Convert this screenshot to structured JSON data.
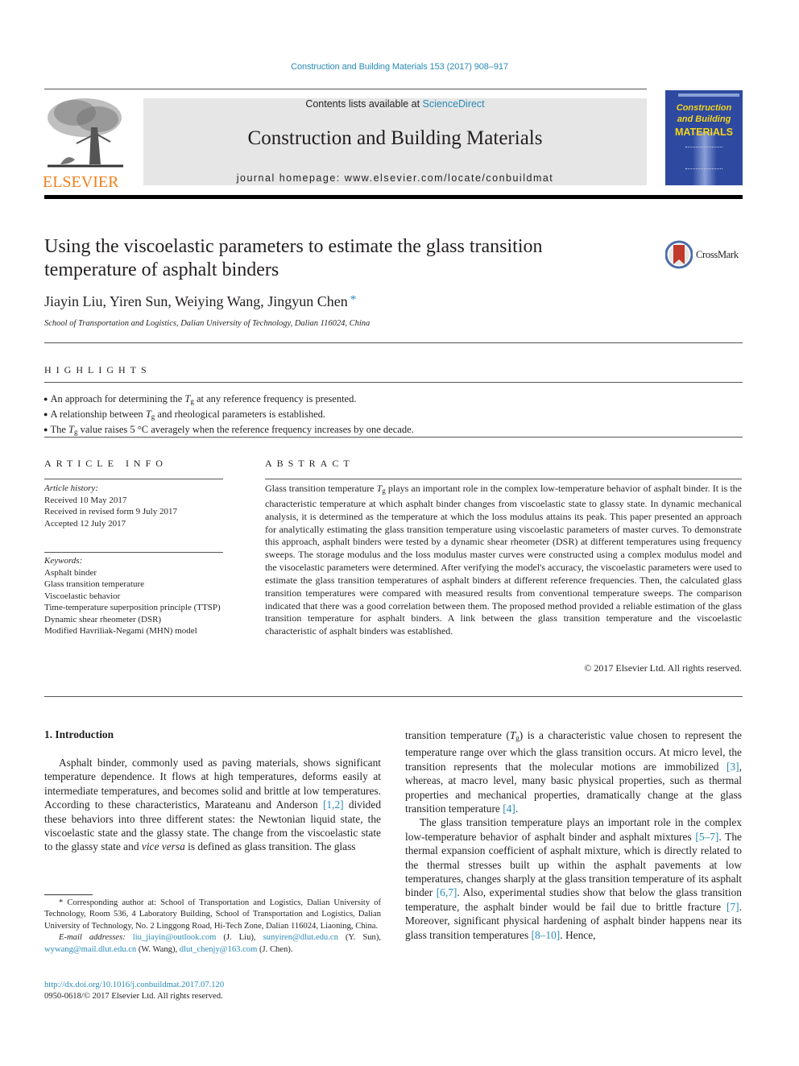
{
  "header": {
    "journal_ref": "Construction and Building Materials 153 (2017) 908–917",
    "contents_prefix": "Contents lists available at ",
    "contents_link": "ScienceDirect",
    "journal_name": "Construction and Building Materials",
    "homepage": "journal homepage: www.elsevier.com/locate/conbuildmat",
    "publisher_logo_text": "ELSEVIER",
    "cover": {
      "title_line1": "Construction",
      "title_line2": "and Building",
      "title_line3": "MATERIALS"
    },
    "colors": {
      "link": "#2a8ab5",
      "elsevier_orange": "#f07f1b",
      "cover_blue": "#2e4aa0",
      "cover_yellow": "#f5d41a",
      "masthead_gray": "#e6e6e6"
    }
  },
  "article": {
    "title": "Using the viscoelastic parameters to estimate the glass transition temperature of asphalt binders",
    "crossmark_label": "CrossMark",
    "authors": "Jiayin Liu, Yiren Sun, Weiying Wang, Jingyun Chen",
    "corresponding_mark": "*",
    "affiliation": "School of Transportation and Logistics, Dalian University of Technology, Dalian 116024, China"
  },
  "highlights": {
    "heading": "HIGHLIGHTS",
    "items": [
      {
        "pre": "An approach for determining the ",
        "sym": "T",
        "sub": "g",
        "post": " at any reference frequency is presented."
      },
      {
        "pre": "A relationship between ",
        "sym": "T",
        "sub": "g",
        "post": " and rheological parameters is established."
      },
      {
        "pre": "The ",
        "sym": "T",
        "sub": "g",
        "post": " value raises 5 °C averagely when the reference frequency increases by one decade."
      }
    ]
  },
  "article_info": {
    "heading": "ARTICLE INFO",
    "history_label": "Article history:",
    "history": [
      "Received 10 May 2017",
      "Received in revised form 9 July 2017",
      "Accepted 12 July 2017"
    ],
    "keywords_label": "Keywords:",
    "keywords": [
      "Asphalt binder",
      "Glass transition temperature",
      "Viscoelastic behavior",
      "Time-temperature superposition principle (TTSP)",
      "Dynamic shear rheometer (DSR)",
      "Modified Havriliak-Negami (MHN) model"
    ]
  },
  "abstract": {
    "heading": "ABSTRACT",
    "lead": "Glass transition temperature ",
    "sym": "T",
    "sub": "g",
    "text": " plays an important role in the complex low-temperature behavior of asphalt binder. It is the characteristic temperature at which asphalt binder changes from viscoelastic state to glassy state. In dynamic mechanical analysis, it is determined as the temperature at which the loss modulus attains its peak. This paper presented an approach for analytically estimating the glass transition temperature using viscoelastic parameters of master curves. To demonstrate this approach, asphalt binders were tested by a dynamic shear rheometer (DSR) at different temperatures using frequency sweeps. The storage modulus and the loss modulus master curves were constructed using a complex modulus model and the visocelastic parameters were determined. After verifying the model's accuracy, the viscoelastic parameters were used to estimate the glass transition temperatures of asphalt binders at different reference frequencies. Then, the calculated glass transition temperatures were compared with measured results from conventional temperature sweeps. The comparison indicated that there was a good correlation between them. The proposed method provided a reliable estimation of the glass transition temperature for asphalt binders. A link between the glass transition temperature and the viscoelastic characteristic of asphalt binders was established.",
    "copyright": "© 2017 Elsevier Ltd. All rights reserved."
  },
  "body": {
    "section_heading": "1. Introduction",
    "left_para": {
      "p1": "Asphalt binder, commonly used as paving materials, shows significant temperature dependence. It flows at high temperatures, deforms easily at intermediate temperatures, and becomes solid and brittle at low temperatures. According to these characteristics, Marateanu and Anderson ",
      "ref1": "[1,2]",
      "p2": " divided these behaviors into three different states: the Newtonian liquid state, the viscoelastic state and the glassy state. The change from the viscoelastic state to the glassy state and ",
      "italic": "vice versa",
      "p3": " is defined as glass transition. The glass"
    },
    "right_para1": {
      "p1": "transition temperature (",
      "sym": "T",
      "sub": "g",
      "p2": ") is a characteristic value chosen to represent the temperature range over which the glass transition occurs. At micro level, the transition represents that the molecular motions are immobilized ",
      "ref3": "[3]",
      "p3": ", whereas, at macro level, many basic physical properties, such as thermal properties and mechanical properties, dramatically change at the glass transition temperature ",
      "ref4": "[4]",
      "p4": "."
    },
    "right_para2": {
      "p1": "The glass transition temperature plays an important role in the complex low-temperature behavior of asphalt binder and asphalt mixtures ",
      "ref5": "[5–7]",
      "p2": ". The thermal expansion coefficient of asphalt mixture, which is directly related to the thermal stresses built up within the asphalt pavements at low temperatures, changes sharply at the glass transition temperature of its asphalt binder ",
      "ref6": "[6,7]",
      "p3": ". Also, experimental studies show that below the glass transition temperature, the asphalt binder would be fail due to brittle fracture ",
      "ref7": "[7]",
      "p4": ". Moreover, significant physical hardening of asphalt binder happens near its glass transition temperatures ",
      "ref8": "[8–10]",
      "p5": ". Hence,"
    }
  },
  "footnote": {
    "star": "*",
    "corresponding": " Corresponding author at: School of Transportation and Logistics, Dalian University of Technology, Room 536, 4 Laboratory Building, School of Transportation and Logistics, Dalian University of Technology, No. 2 Linggong Road, Hi-Tech Zone, Dalian 116024, Liaoning, China.",
    "email_label": "E-mail addresses:",
    "emails": [
      {
        "addr": "liu_jiayin@outlook.com",
        "who": " (J. Liu), "
      },
      {
        "addr": "sunyiren@dlut.edu.cn",
        "who": " (Y. Sun), "
      },
      {
        "addr": "wywang@mail.dlut.edu.cn",
        "who": " (W. Wang), "
      },
      {
        "addr": "dlut_chenjy@163.com",
        "who": " (J. Chen)."
      }
    ],
    "doi": "http://dx.doi.org/10.1016/j.conbuildmat.2017.07.120",
    "issn": "0950-0618/© 2017 Elsevier Ltd. All rights reserved."
  }
}
